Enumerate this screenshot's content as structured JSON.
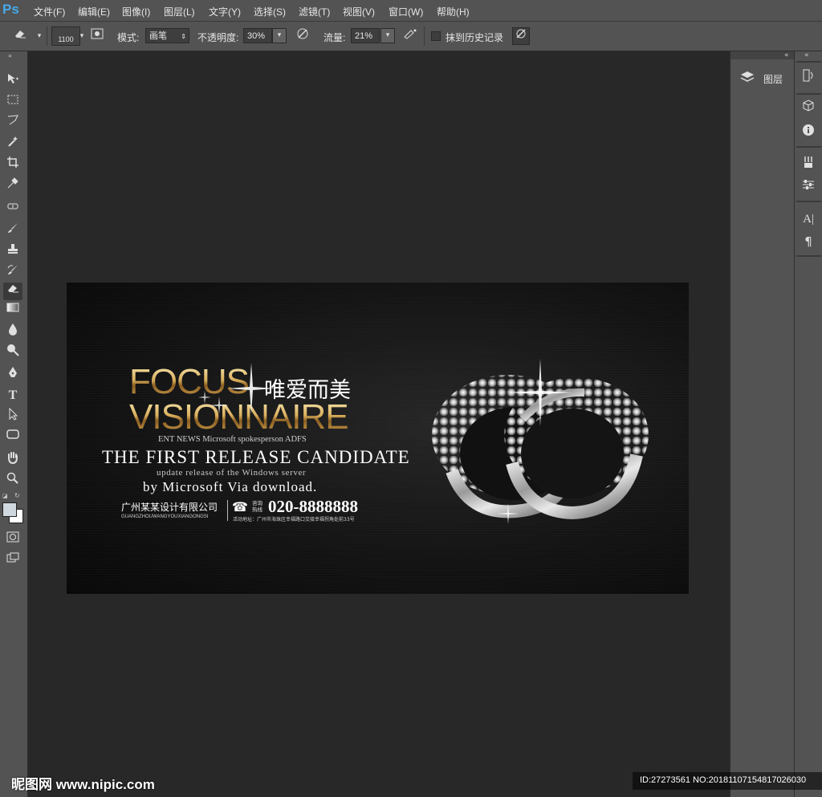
{
  "app": {
    "logo": "Ps",
    "accent": "#47a9ea"
  },
  "menu": [
    {
      "label": "文件(F)"
    },
    {
      "label": "编辑(E)"
    },
    {
      "label": "图像(I)"
    },
    {
      "label": "图层(L)"
    },
    {
      "label": "文字(Y)"
    },
    {
      "label": "选择(S)"
    },
    {
      "label": "滤镜(T)"
    },
    {
      "label": "视图(V)"
    },
    {
      "label": "窗口(W)"
    },
    {
      "label": "帮助(H)"
    }
  ],
  "options": {
    "brush_size": "1100",
    "mode_label": "模式:",
    "mode_value": "画笔",
    "opacity_label": "不透明度:",
    "opacity_value": "30%",
    "flow_label": "流量:",
    "flow_value": "21%",
    "erase_history_label": "抹到历史记录",
    "erase_history_checked": false
  },
  "tools": [
    {
      "icon": "move-icon"
    },
    {
      "icon": "marquee-icon"
    },
    {
      "icon": "lasso-icon"
    },
    {
      "icon": "magic-wand-icon"
    },
    {
      "icon": "crop-icon"
    },
    {
      "icon": "eyedropper-icon"
    },
    {
      "icon": "healing-brush-icon"
    },
    {
      "icon": "brush-icon"
    },
    {
      "icon": "stamp-icon"
    },
    {
      "icon": "history-brush-icon"
    },
    {
      "icon": "eraser-icon"
    },
    {
      "icon": "gradient-icon"
    },
    {
      "icon": "blur-icon"
    },
    {
      "icon": "dodge-icon"
    },
    {
      "icon": "pen-icon"
    },
    {
      "icon": "type-icon"
    },
    {
      "icon": "path-select-icon"
    },
    {
      "icon": "shape-icon"
    },
    {
      "icon": "hand-icon"
    },
    {
      "icon": "zoom-icon"
    }
  ],
  "colors": {
    "foreground": "#cfd8df",
    "background": "#ffffff"
  },
  "document": {
    "title_line1": "FOCUS",
    "title_line2": "VISIONNAIRE",
    "slogan_cn": "唯爱而美",
    "ent_news": "ENT NEWS Microsoft spokesperson ADFS",
    "headline": "THE FIRST RELEASE CANDIDATE",
    "update_line": "update release of the Windows server",
    "by_line": "by Microsoft Via download.",
    "company_cn": "广州某某设计有限公司",
    "company_pinyin": "GUANGZHOUWANGYOUXIANGONGSI",
    "hotline_label": "咨询热线",
    "phone": "020-8888888",
    "address": "活动地址：广州市海珠区幸福路口交接幸福拐角处前33号"
  },
  "panels": {
    "layers_label": "图层"
  },
  "watermark": {
    "left": "昵图网 www.nipic.com",
    "right": "ID:27273561 NO:20181107154817026030"
  }
}
